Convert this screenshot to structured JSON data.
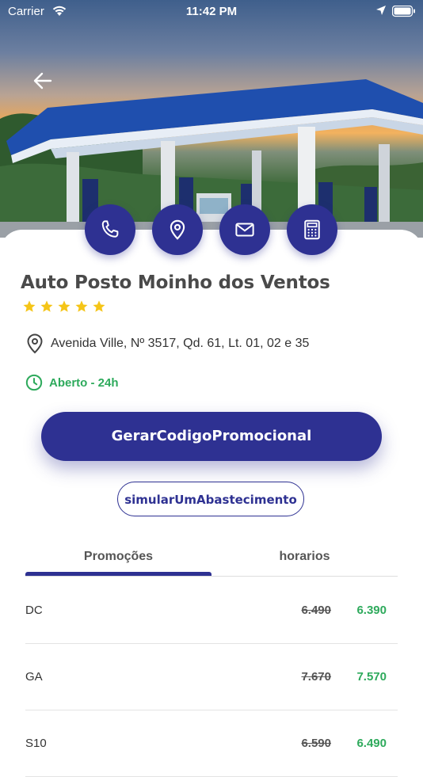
{
  "status_bar": {
    "carrier": "Carrier",
    "time": "11:42 PM"
  },
  "station": {
    "name": "Auto Posto Moinho dos Ventos",
    "rating": 5,
    "address": "Avenida Ville, Nº 3517, Qd. 61, Lt. 01, 02 e 35",
    "hours": "Aberto - 24h"
  },
  "actions": {
    "icons": [
      "phone-icon",
      "location-pin-icon",
      "mail-icon",
      "calculator-icon"
    ]
  },
  "buttons": {
    "promo": "GerarCodigoPromocional",
    "simulate": "simularUmAbastecimento"
  },
  "tabs": [
    {
      "label": "Promoções",
      "active": true
    },
    {
      "label": "horarios",
      "active": false
    }
  ],
  "prices": [
    {
      "fuel": "DC",
      "old": "6.490",
      "new": "6.390"
    },
    {
      "fuel": "GA",
      "old": "7.670",
      "new": "7.570"
    },
    {
      "fuel": "S10",
      "old": "6.590",
      "new": "6.490"
    }
  ],
  "colors": {
    "primary": "#2e3192",
    "success": "#2eaa5c",
    "star": "#f5c518"
  }
}
